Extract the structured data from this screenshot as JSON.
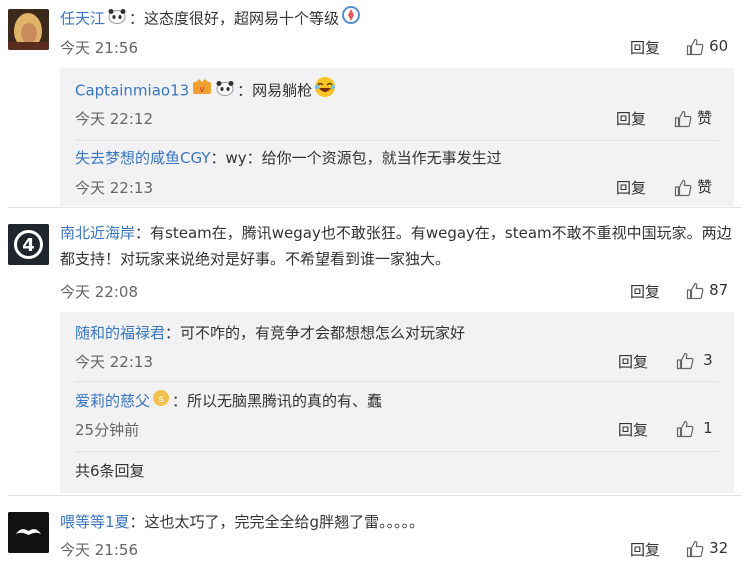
{
  "colors": {
    "link": "#3a76c2",
    "reply_bg": "#f2f2f5",
    "text": "#333333",
    "meta": "#666666"
  },
  "comments": [
    {
      "user": "任天江",
      "text": "：这态度很好，超网易十个等级",
      "time": "今天 21:56",
      "reply_label": "回复",
      "likes": "60",
      "avatar_icon": "blonde-avatar",
      "replies": [
        {
          "user": "Captainmiao13",
          "text": "：网易躺枪",
          "time": "今天 22:12",
          "reply_label": "回复",
          "likes": "赞"
        },
        {
          "user": "失去梦想的咸鱼CGY",
          "text": "：wy：给你一个资源包，就当作无事发生过",
          "time": "今天 22:13",
          "reply_label": "回复",
          "likes": "赞"
        }
      ]
    },
    {
      "user": "南北近海岸",
      "text_line1": "：有steam在，腾讯wegay也不敢张狂。有wegay在，steam不敢不重视中国玩家。两边",
      "text_line2": "都支持！对玩家来说绝对是好事。不希望看到谁一家独大。",
      "time": "今天 22:08",
      "reply_label": "回复",
      "likes": "87",
      "avatar_icon": "number-4-avatar",
      "replies": [
        {
          "user": "随和的福禄君",
          "text": "：可不咋的，有竞争才会都想想怎么对玩家好",
          "time": "今天 22:13",
          "reply_label": "回复",
          "likes": "3"
        },
        {
          "user": "爱莉的慈父",
          "text": "：所以无脑黑腾讯的真的有、蠢",
          "time": "25分钟前",
          "reply_label": "回复",
          "likes": "1"
        }
      ],
      "more_replies": "共6条回复"
    },
    {
      "user": "喂等等1夏",
      "text": "：这也太巧了，完完全全给g胖翘了雷。。。。。",
      "time": "今天 21:56",
      "reply_label": "回复",
      "likes": "32",
      "avatar_icon": "mustache-avatar"
    }
  ]
}
